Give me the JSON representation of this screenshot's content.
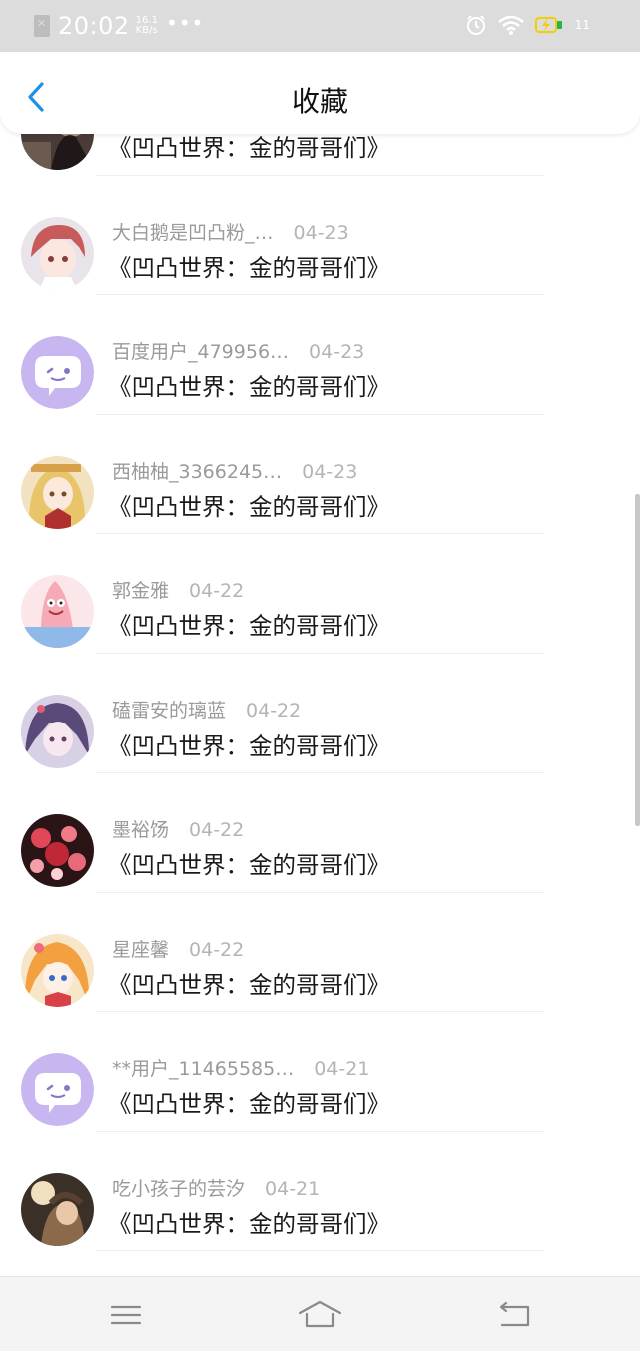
{
  "status_bar": {
    "time": "20:02",
    "speed_value": "16.1",
    "speed_unit": "KB/s",
    "dots": "•••",
    "battery": "11",
    "icons": [
      "sim-off-icon",
      "alarm-icon",
      "wifi-icon",
      "charging-icon"
    ]
  },
  "header": {
    "title": "收藏",
    "back_icon": "back-arrow-icon"
  },
  "items": [
    {
      "user": "",
      "date": "",
      "title": "《凹凸世界：金的哥哥们》",
      "avatar": "dark-anime"
    },
    {
      "user": "大白鹅是凹凸粉_…",
      "date": "04-23",
      "title": "《凹凸世界：金的哥哥们》",
      "avatar": "pink-hair-anime"
    },
    {
      "user": "百度用户_479956…",
      "date": "04-23",
      "title": "《凹凸世界：金的哥哥们》",
      "avatar": "default-chat-icon"
    },
    {
      "user": "西柚柚_3366245…",
      "date": "04-23",
      "title": "《凹凸世界：金的哥哥们》",
      "avatar": "blonde-anime"
    },
    {
      "user": "郭金雅",
      "date": "04-22",
      "title": "《凹凸世界：金的哥哥们》",
      "avatar": "patrick-star"
    },
    {
      "user": "磕雷安的璃蓝",
      "date": "04-22",
      "title": "《凹凸世界：金的哥哥们》",
      "avatar": "purple-anime"
    },
    {
      "user": "墨裕饧",
      "date": "04-22",
      "title": "《凹凸世界：金的哥哥们》",
      "avatar": "red-flowers"
    },
    {
      "user": "星座馨",
      "date": "04-22",
      "title": "《凹凸世界：金的哥哥们》",
      "avatar": "orange-hair-anime"
    },
    {
      "user": "**用户_11465585…",
      "date": "04-21",
      "title": "《凹凸世界：金的哥哥们》",
      "avatar": "default-chat-icon"
    },
    {
      "user": "吃小孩子的芸汐",
      "date": "04-21",
      "title": "《凹凸世界：金的哥哥们》",
      "avatar": "brown-anime"
    }
  ],
  "navbar": {
    "icons": [
      "menu-icon",
      "home-icon",
      "back-icon"
    ]
  },
  "colors": {
    "accent": "#1e90e6",
    "status_bar_bg": "#dcdcdc",
    "default_avatar": "#c8b6f0"
  }
}
